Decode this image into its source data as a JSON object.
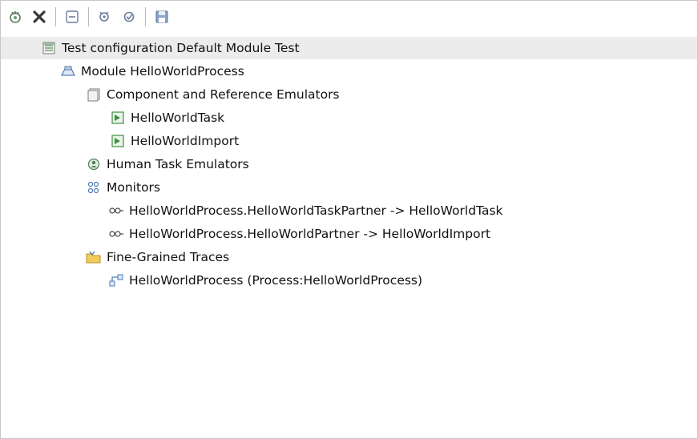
{
  "toolbar": {
    "buttons": [
      {
        "icon": "add-emulator-icon"
      },
      {
        "icon": "remove-icon"
      },
      {
        "icon": "collapse-all-icon"
      },
      {
        "icon": "add-monitor-icon"
      },
      {
        "icon": "add-trace-icon"
      },
      {
        "icon": "save-icon"
      }
    ]
  },
  "tree": {
    "root_label": "Test configuration Default Module Test",
    "module_label": "Module HelloWorldProcess",
    "component_emulators_label": "Component and Reference Emulators",
    "emulator_task_label": "HelloWorldTask",
    "emulator_import_label": "HelloWorldImport",
    "human_task_emulators_label": "Human Task Emulators",
    "monitors_label": "Monitors",
    "monitor_1_label": "HelloWorldProcess.HelloWorldTaskPartner -> HelloWorldTask",
    "monitor_2_label": "HelloWorldProcess.HelloWorldPartner -> HelloWorldImport",
    "traces_label": "Fine-Grained Traces",
    "trace_process_label": "HelloWorldProcess (Process:HelloWorldProcess)"
  },
  "colors": {
    "root_row_bg": "#ececec",
    "icon_green": "#3f8f3f",
    "icon_blue": "#4a78b5",
    "icon_folder": "#e6b840"
  }
}
